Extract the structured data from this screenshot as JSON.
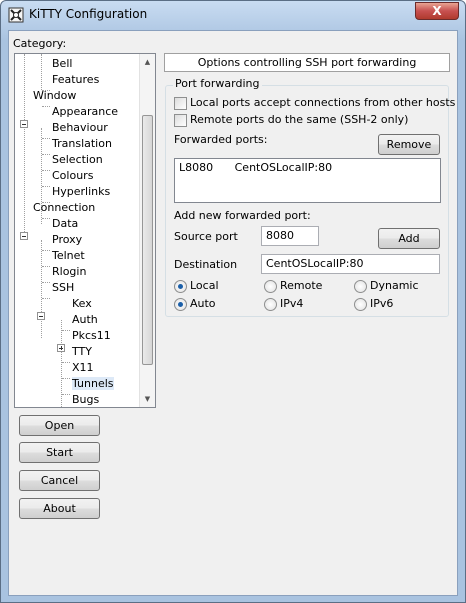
{
  "window": {
    "title": "KiTTY Configuration",
    "close_glyph": "X"
  },
  "category_label": "Category:",
  "tree": {
    "items": [
      {
        "label": "Bell"
      },
      {
        "label": "Features"
      },
      {
        "label": "Window"
      },
      {
        "label": "Appearance"
      },
      {
        "label": "Behaviour"
      },
      {
        "label": "Translation"
      },
      {
        "label": "Selection"
      },
      {
        "label": "Colours"
      },
      {
        "label": "Hyperlinks"
      },
      {
        "label": "Connection"
      },
      {
        "label": "Data"
      },
      {
        "label": "Proxy"
      },
      {
        "label": "Telnet"
      },
      {
        "label": "Rlogin"
      },
      {
        "label": "SSH"
      },
      {
        "label": "Kex"
      },
      {
        "label": "Auth"
      },
      {
        "label": "Pkcs11"
      },
      {
        "label": "TTY"
      },
      {
        "label": "X11"
      },
      {
        "label": "Tunnels",
        "selected": true
      },
      {
        "label": "Bugs"
      }
    ]
  },
  "buttons": {
    "open": "Open",
    "start": "Start",
    "cancel": "Cancel",
    "about": "About"
  },
  "panel": {
    "header": "Options controlling SSH port forwarding",
    "group_title": "Port forwarding",
    "local_ports_label": "Local ports accept connections from other hosts",
    "local_ports_checked": false,
    "remote_ports_label": "Remote ports do the same (SSH-2 only)",
    "remote_ports_checked": false,
    "forwarded_ports_label": "Forwarded ports:",
    "remove_label": "Remove",
    "forwarded": [
      {
        "port": "L8080",
        "destination": "CentOSLocalIP:80"
      }
    ],
    "add_new_label": "Add new forwarded port:",
    "source_port_label": "Source port",
    "source_port_value": "8080",
    "add_label": "Add",
    "destination_label": "Destination",
    "destination_value": "CentOSLocalIP:80",
    "direction": {
      "local": "Local",
      "remote": "Remote",
      "dynamic": "Dynamic",
      "selected": "Local"
    },
    "ipversion": {
      "auto": "Auto",
      "ipv4": "IPv4",
      "ipv6": "IPv6",
      "selected": "Auto"
    }
  },
  "colors": {
    "title_gradient_top": "#c9dcf2",
    "title_gradient_bottom": "#a9c3e0",
    "client_bg": "#f0f0f0",
    "close_button": "#c75050",
    "radio_dot": "#1b5fa8"
  }
}
